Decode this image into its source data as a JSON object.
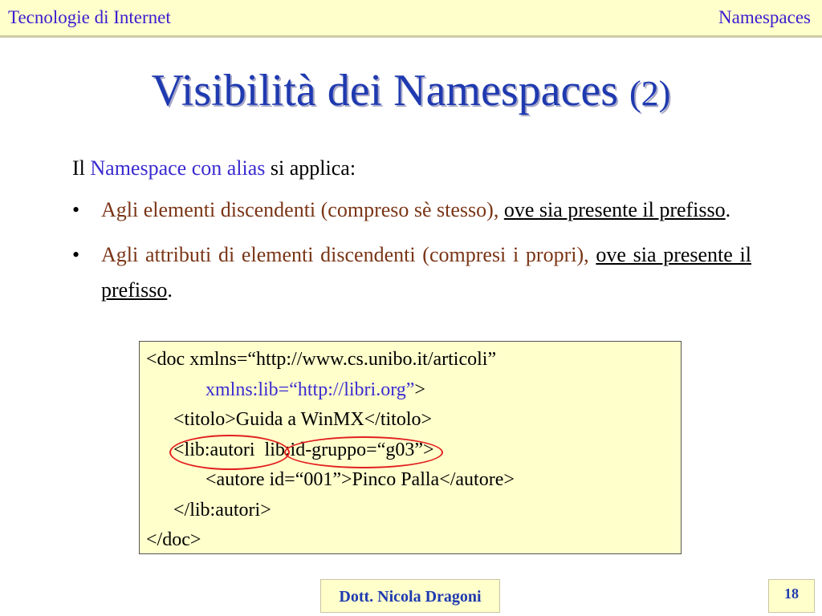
{
  "header": {
    "left": "Tecnologie di Internet",
    "right": "Namespaces"
  },
  "title": {
    "main": "Visibilità dei Namespaces",
    "number": "(2)"
  },
  "intro": {
    "prefix": "Il ",
    "highlight": "Namespace con alias",
    "suffix": " si applica:"
  },
  "bullets": [
    {
      "marker": "•",
      "text": "Agli elementi discendenti (compreso sè stesso), ",
      "underlined": "ove sia presente il prefisso",
      "end": "."
    },
    {
      "marker": "•",
      "text": "Agli attributi di elementi discendenti (compresi i propri), ",
      "underlined": "ove sia presente il prefisso",
      "end": "."
    }
  ],
  "code": {
    "line1": "<doc xmlns=“http://www.cs.unibo.it/articoli”",
    "line2_attr": "xmlns:lib=“http://libri.org”",
    "line2_end": ">",
    "line3": "<titolo>Guida a WinMX</titolo>",
    "line4": "<lib:autori  lib:id-gruppo=“g03”>",
    "line5": "<autore id=“001”>Pinco Palla</autore>",
    "line6": "</lib:autori>",
    "line7": "</doc>"
  },
  "footer": {
    "author": "Dott. Nicola Dragoni",
    "page": "18"
  },
  "colors": {
    "header_bg": "#ffffcc",
    "title": "#1f3ab0",
    "accent_blue": "#3a2bd0",
    "bullet_text": "#7a3516",
    "highlight_circle": "#e21f1f"
  }
}
